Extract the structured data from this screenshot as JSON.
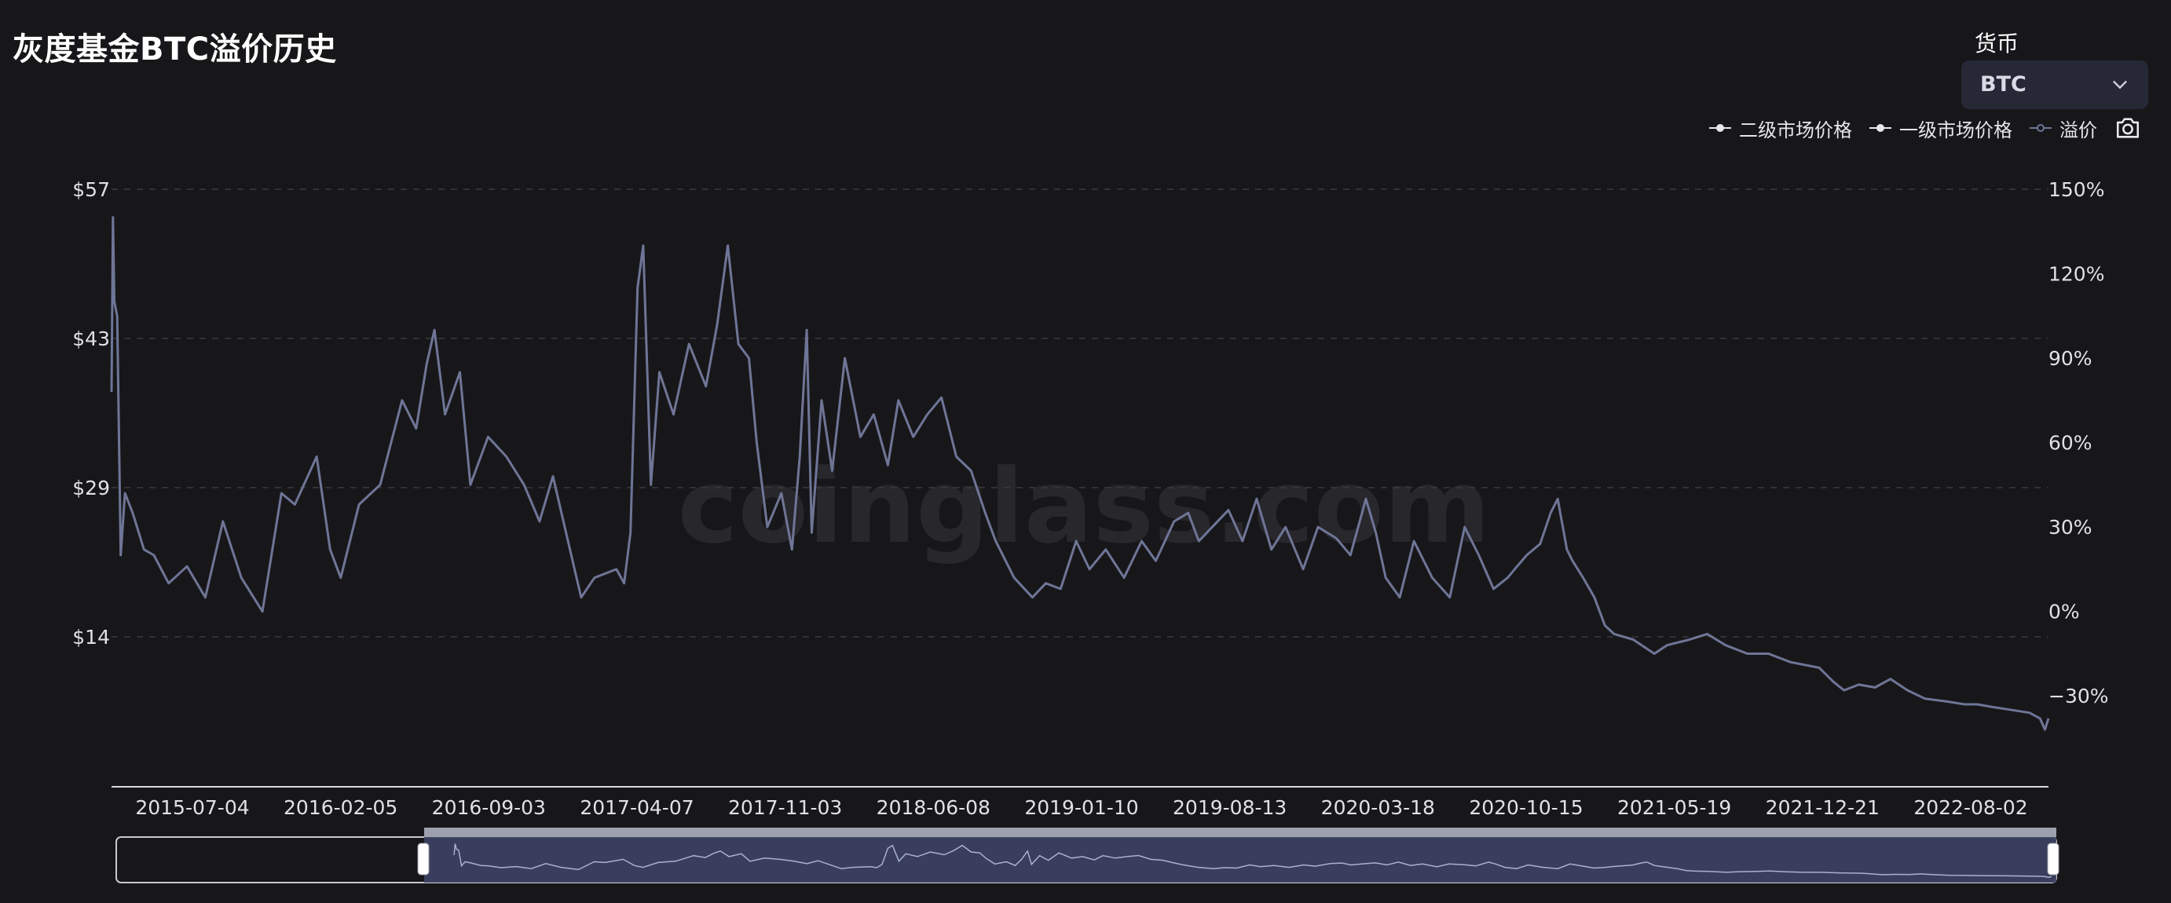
{
  "page_title": "灰度基金BTC溢价历史",
  "currency": {
    "label": "货币",
    "selected": "BTC"
  },
  "legend": [
    {
      "name": "二级市场价格",
      "color": "#e8e8ee"
    },
    {
      "name": "一级市场价格",
      "color": "#e8e8ee"
    },
    {
      "name": "溢价",
      "color": "#6f7596"
    }
  ],
  "icons": {
    "dropdown": "chevron-down-icon",
    "save_image": "camera-icon"
  },
  "watermark": "coinglass.com",
  "colors": {
    "background": "#17171a",
    "premium_line": "#6f7596",
    "slider_fill": "#3c4263",
    "grid": "#3a3a40"
  },
  "chart_data": {
    "type": "line",
    "left_axis": {
      "ticks": [
        "$14",
        "$29",
        "$43",
        "$57"
      ]
    },
    "right_axis": {
      "ticks": [
        "150%",
        "120%",
        "90%",
        "60%",
        "30%",
        "0%",
        "-30%"
      ],
      "range": [
        -45,
        150
      ]
    },
    "x_ticks": [
      "2015-07-04",
      "2016-02-05",
      "2016-09-03",
      "2017-04-07",
      "2017-11-03",
      "2018-06-08",
      "2019-01-10",
      "2019-08-13",
      "2020-03-18",
      "2020-10-15",
      "2021-05-19",
      "2021-12-21",
      "2022-08-02"
    ],
    "x_range": [
      "2015-05-05",
      "2022-11-11"
    ],
    "series": [
      {
        "name": "溢价",
        "points": [
          [
            "2015-05-05",
            78
          ],
          [
            "2015-05-07",
            140
          ],
          [
            "2015-05-09",
            110
          ],
          [
            "2015-05-13",
            105
          ],
          [
            "2015-05-18",
            20
          ],
          [
            "2015-05-24",
            42
          ],
          [
            "2015-06-04",
            35
          ],
          [
            "2015-06-20",
            22
          ],
          [
            "2015-07-04",
            20
          ],
          [
            "2015-07-25",
            10
          ],
          [
            "2015-08-20",
            16
          ],
          [
            "2015-09-15",
            5
          ],
          [
            "2015-10-10",
            32
          ],
          [
            "2015-11-05",
            12
          ],
          [
            "2015-12-05",
            0
          ],
          [
            "2016-01-01",
            42
          ],
          [
            "2016-01-20",
            38
          ],
          [
            "2016-02-20",
            55
          ],
          [
            "2016-03-10",
            22
          ],
          [
            "2016-03-25",
            12
          ],
          [
            "2016-04-20",
            38
          ],
          [
            "2016-05-20",
            45
          ],
          [
            "2016-06-20",
            75
          ],
          [
            "2016-07-10",
            65
          ],
          [
            "2016-07-25",
            88
          ],
          [
            "2016-08-05",
            100
          ],
          [
            "2016-08-20",
            70
          ],
          [
            "2016-09-10",
            85
          ],
          [
            "2016-09-25",
            45
          ],
          [
            "2016-10-20",
            62
          ],
          [
            "2016-11-15",
            55
          ],
          [
            "2016-12-10",
            45
          ],
          [
            "2017-01-01",
            32
          ],
          [
            "2017-01-20",
            48
          ],
          [
            "2017-02-15",
            20
          ],
          [
            "2017-03-01",
            5
          ],
          [
            "2017-03-20",
            12
          ],
          [
            "2017-04-20",
            15
          ],
          [
            "2017-05-01",
            10
          ],
          [
            "2017-05-10",
            28
          ],
          [
            "2017-05-20",
            115
          ],
          [
            "2017-05-28",
            130
          ],
          [
            "2017-06-08",
            45
          ],
          [
            "2017-06-20",
            85
          ],
          [
            "2017-07-10",
            70
          ],
          [
            "2017-08-01",
            95
          ],
          [
            "2017-08-25",
            80
          ],
          [
            "2017-09-10",
            102
          ],
          [
            "2017-09-25",
            130
          ],
          [
            "2017-10-10",
            95
          ],
          [
            "2017-10-25",
            90
          ],
          [
            "2017-11-05",
            60
          ],
          [
            "2017-11-20",
            30
          ],
          [
            "2017-12-10",
            42
          ],
          [
            "2017-12-25",
            22
          ],
          [
            "2018-01-05",
            55
          ],
          [
            "2018-01-15",
            100
          ],
          [
            "2018-01-22",
            28
          ],
          [
            "2018-02-05",
            75
          ],
          [
            "2018-02-20",
            50
          ],
          [
            "2018-03-10",
            90
          ],
          [
            "2018-04-01",
            62
          ],
          [
            "2018-04-20",
            70
          ],
          [
            "2018-05-10",
            52
          ],
          [
            "2018-05-25",
            75
          ],
          [
            "2018-06-15",
            62
          ],
          [
            "2018-07-05",
            70
          ],
          [
            "2018-07-25",
            76
          ],
          [
            "2018-08-15",
            55
          ],
          [
            "2018-09-05",
            50
          ],
          [
            "2018-09-25",
            35
          ],
          [
            "2018-10-10",
            25
          ],
          [
            "2018-11-05",
            12
          ],
          [
            "2018-12-01",
            5
          ],
          [
            "2018-12-20",
            10
          ],
          [
            "2019-01-10",
            8
          ],
          [
            "2019-02-01",
            25
          ],
          [
            "2019-02-20",
            15
          ],
          [
            "2019-03-15",
            22
          ],
          [
            "2019-04-10",
            12
          ],
          [
            "2019-05-05",
            25
          ],
          [
            "2019-05-25",
            18
          ],
          [
            "2019-06-20",
            32
          ],
          [
            "2019-07-10",
            35
          ],
          [
            "2019-07-25",
            25
          ],
          [
            "2019-08-13",
            30
          ],
          [
            "2019-09-05",
            36
          ],
          [
            "2019-09-25",
            25
          ],
          [
            "2019-10-15",
            40
          ],
          [
            "2019-11-05",
            22
          ],
          [
            "2019-11-25",
            30
          ],
          [
            "2019-12-20",
            15
          ],
          [
            "2020-01-10",
            30
          ],
          [
            "2020-02-05",
            26
          ],
          [
            "2020-02-25",
            20
          ],
          [
            "2020-03-18",
            40
          ],
          [
            "2020-04-01",
            28
          ],
          [
            "2020-04-15",
            12
          ],
          [
            "2020-05-05",
            5
          ],
          [
            "2020-05-25",
            25
          ],
          [
            "2020-06-20",
            12
          ],
          [
            "2020-07-15",
            5
          ],
          [
            "2020-08-05",
            30
          ],
          [
            "2020-08-25",
            20
          ],
          [
            "2020-09-15",
            8
          ],
          [
            "2020-10-05",
            12
          ],
          [
            "2020-10-15",
            15
          ],
          [
            "2020-11-01",
            20
          ],
          [
            "2020-11-20",
            24
          ],
          [
            "2020-12-05",
            35
          ],
          [
            "2020-12-15",
            40
          ],
          [
            "2020-12-28",
            22
          ],
          [
            "2021-01-05",
            18
          ],
          [
            "2021-01-20",
            12
          ],
          [
            "2021-02-05",
            5
          ],
          [
            "2021-02-20",
            -5
          ],
          [
            "2021-03-05",
            -8
          ],
          [
            "2021-04-01",
            -10
          ],
          [
            "2021-05-01",
            -15
          ],
          [
            "2021-05-19",
            -12
          ],
          [
            "2021-06-20",
            -10
          ],
          [
            "2021-07-15",
            -8
          ],
          [
            "2021-08-10",
            -12
          ],
          [
            "2021-09-10",
            -15
          ],
          [
            "2021-10-10",
            -15
          ],
          [
            "2021-11-10",
            -18
          ],
          [
            "2021-12-21",
            -20
          ],
          [
            "2022-01-10",
            -25
          ],
          [
            "2022-01-25",
            -28
          ],
          [
            "2022-02-15",
            -26
          ],
          [
            "2022-03-10",
            -27
          ],
          [
            "2022-04-01",
            -24
          ],
          [
            "2022-04-25",
            -28
          ],
          [
            "2022-05-20",
            -31
          ],
          [
            "2022-06-20",
            -32
          ],
          [
            "2022-07-15",
            -33
          ],
          [
            "2022-08-02",
            -33
          ],
          [
            "2022-08-25",
            -34
          ],
          [
            "2022-09-20",
            -35
          ],
          [
            "2022-10-15",
            -36
          ],
          [
            "2022-10-30",
            -38
          ],
          [
            "2022-11-06",
            -42
          ],
          [
            "2022-11-11",
            -38
          ]
        ]
      }
    ]
  }
}
